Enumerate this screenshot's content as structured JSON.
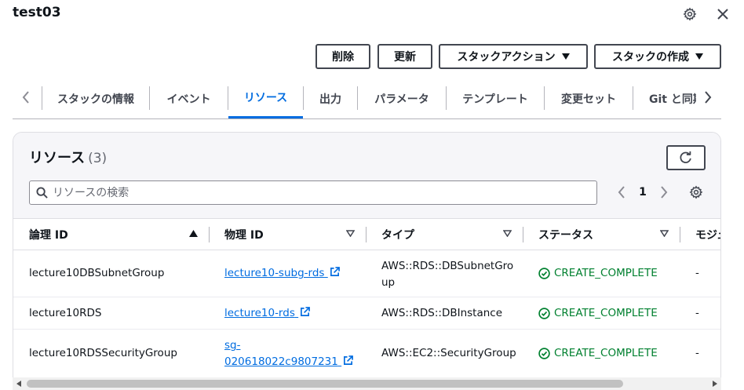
{
  "header": {
    "title": "test03"
  },
  "actions": {
    "delete_label": "削除",
    "update_label": "更新",
    "stack_actions_label": "スタックアクション",
    "create_stack_label": "スタックの作成"
  },
  "tabs": [
    {
      "label": "スタックの情報"
    },
    {
      "label": "イベント"
    },
    {
      "label": "リソース"
    },
    {
      "label": "出力"
    },
    {
      "label": "パラメータ"
    },
    {
      "label": "テンプレート"
    },
    {
      "label": "変更セット"
    },
    {
      "label": "Git と同期"
    }
  ],
  "active_tab": "リソース",
  "resources": {
    "title": "リソース",
    "count": "(3)",
    "search_placeholder": "リソースの検索",
    "page": "1",
    "columns": {
      "logical_id": "論理 ID",
      "physical_id": "物理 ID",
      "type": "タイプ",
      "status": "ステータス",
      "module": "モジュール"
    },
    "rows": [
      {
        "logical_id": "lecture10DBSubnetGroup",
        "physical_id": "lecture10-subg-rds",
        "type_line1": "AWS::RDS::DBSubnetGro",
        "type_line2": "up",
        "status": "CREATE_COMPLETE",
        "module": "-"
      },
      {
        "logical_id": "lecture10RDS",
        "physical_id": "lecture10-rds",
        "type_line1": "AWS::RDS::DBInstance",
        "type_line2": "",
        "status": "CREATE_COMPLETE",
        "module": "-"
      },
      {
        "logical_id": "lecture10RDSSecurityGroup",
        "physical_id_line1": "sg-",
        "physical_id_line2": "020618022c9807231",
        "type_line1": "AWS::EC2::SecurityGroup",
        "type_line2": "",
        "status": "CREATE_COMPLETE",
        "module": "-"
      }
    ]
  },
  "colors": {
    "accent": "#006ce0",
    "success": "#00802f",
    "text": "#0f141a"
  }
}
